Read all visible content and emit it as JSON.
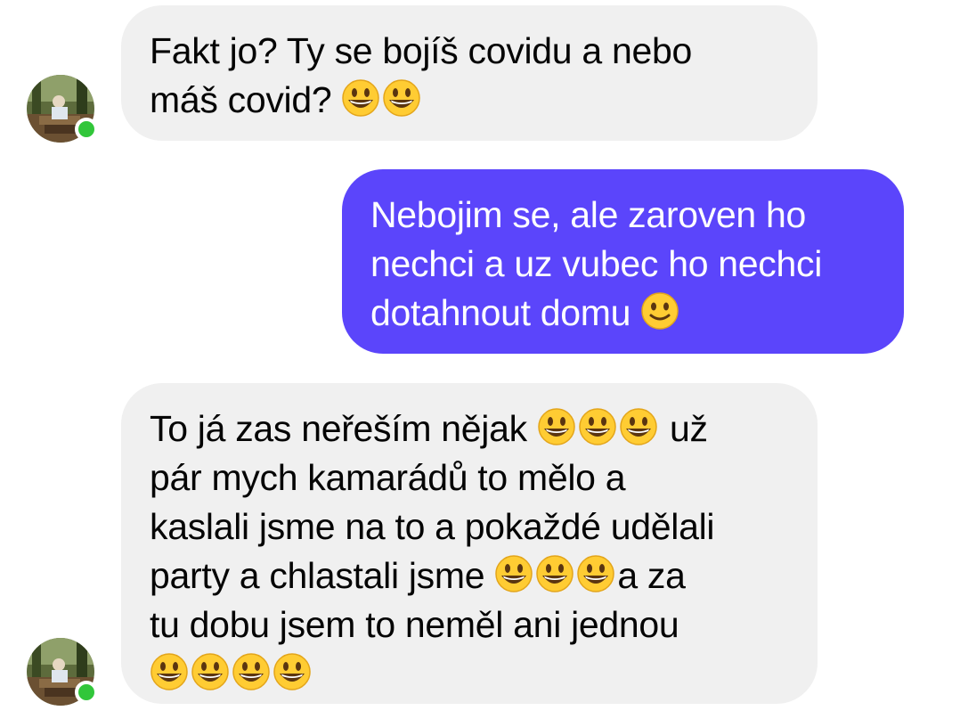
{
  "conversation": {
    "messages": [
      {
        "sender": "contact",
        "lines": [
          {
            "text": "Fakt jo? Ty se bojíš covidu a nebo",
            "emoji_after": 0
          },
          {
            "text": "máš covid? ",
            "emoji_after": 2
          }
        ],
        "emoji": "grinning-face"
      },
      {
        "sender": "me",
        "lines": [
          {
            "text": "Nebojim se, ale zaroven ho",
            "emoji_after": 0
          },
          {
            "text": "nechci a uz vubec ho nechci",
            "emoji_after": 0
          },
          {
            "text": "dotahnout domu ",
            "emoji_after": 1
          }
        ],
        "emoji": "slightly-smiling-face"
      },
      {
        "sender": "contact",
        "lines": [
          {
            "text_before": "To já zas neřeším nějak ",
            "emoji_count": 3,
            "text_after": " už"
          },
          {
            "text_before": "pár mych kamarádů to mělo a"
          },
          {
            "text_before": "kaslali jsme na to a pokaždé udělali"
          },
          {
            "text_before": "party a chlastali jsme ",
            "emoji_count": 3,
            "text_after": "a za"
          },
          {
            "text_before": "tu dobu jsem to neměl ani jednou"
          },
          {
            "text_before": "",
            "emoji_count": 4
          }
        ],
        "emoji": "grinning-face"
      }
    ],
    "contact": {
      "online": true,
      "status_color": "#31c63a"
    },
    "colors": {
      "outgoing_bubble": "#5b45fb",
      "incoming_bubble": "#f0f0f0"
    }
  }
}
